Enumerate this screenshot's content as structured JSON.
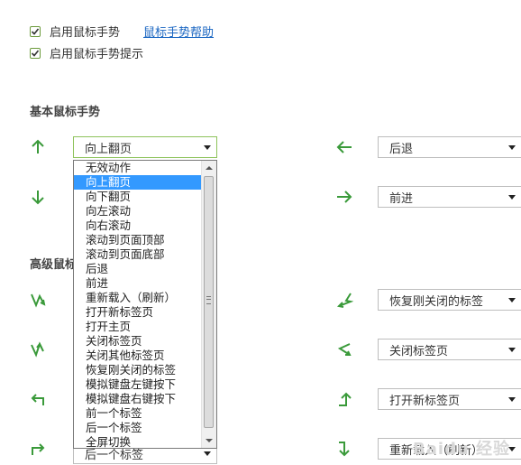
{
  "checkboxes": [
    {
      "label": "启用鼠标手势",
      "checked": true
    },
    {
      "label": "启用鼠标手势提示",
      "checked": true
    }
  ],
  "help_link": "鼠标手势帮助",
  "sections": {
    "basic": "基本鼠标手势",
    "advanced": "高级鼠标"
  },
  "gestures": {
    "left": [
      {
        "icon": "arrow-up-icon",
        "value": "向上翻页"
      },
      {
        "icon": "arrow-down-icon",
        "value": ""
      },
      {
        "icon": "gesture-down-up-icon",
        "value": ""
      },
      {
        "icon": "gesture-up-down-icon",
        "value": ""
      },
      {
        "icon": "gesture-left-up-icon",
        "value": ""
      },
      {
        "icon": "gesture-right-up-icon",
        "value": "后一个标签"
      }
    ],
    "right": [
      {
        "icon": "arrow-left-icon",
        "value": "后退"
      },
      {
        "icon": "arrow-right-icon",
        "value": "前进"
      },
      {
        "icon": "gesture-up-left-icon",
        "value": "恢复刚关闭的标签"
      },
      {
        "icon": "gesture-down-left-icon",
        "value": "关闭标签页"
      },
      {
        "icon": "gesture-right-up-arrow-icon",
        "value": "打开新标签页"
      },
      {
        "icon": "gesture-right-down-icon",
        "value": "重新载入（刷新）"
      }
    ]
  },
  "dropdown": {
    "selected_index": 1,
    "options": [
      "无效动作",
      "向上翻页",
      "向下翻页",
      "向左滚动",
      "向右滚动",
      "滚动到页面顶部",
      "滚动到页面底部",
      "后退",
      "前进",
      "重新载入（刷新）",
      "打开新标签页",
      "打开主页",
      "关闭标签页",
      "关闭其他标签页",
      "恢复刚关闭的标签",
      "模拟键盘左键按下",
      "模拟键盘右键按下",
      "前一个标签",
      "后一个标签",
      "全屏切换"
    ]
  },
  "colors": {
    "arrow": "#3a9a3a",
    "accent": "#8ec35b",
    "selection": "#3399ff",
    "link": "#1a66c2"
  },
  "watermark": "Baidu 经验"
}
